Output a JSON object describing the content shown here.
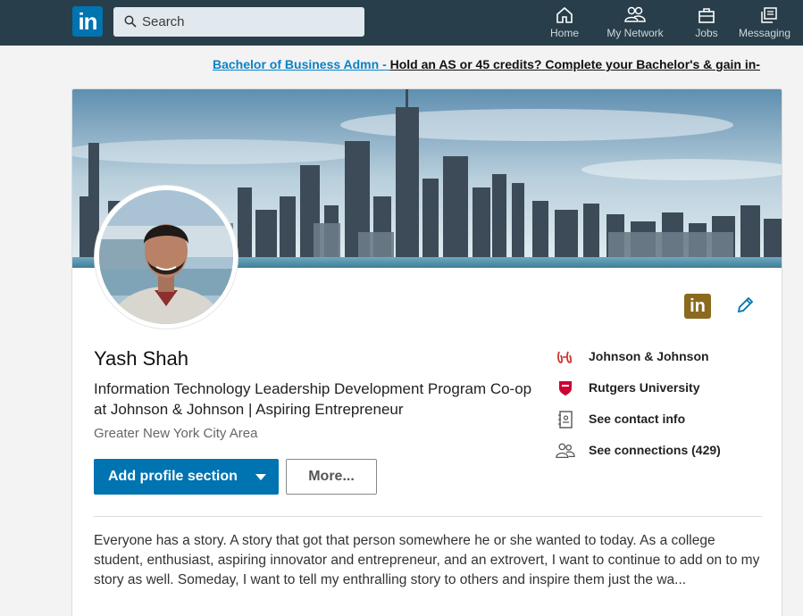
{
  "nav": {
    "logo_text": "in",
    "search_placeholder": "Search",
    "items": [
      {
        "label": "Home",
        "icon": "home-icon"
      },
      {
        "label": "My Network",
        "icon": "network-icon"
      },
      {
        "label": "Jobs",
        "icon": "briefcase-icon"
      },
      {
        "label": "Messaging",
        "icon": "messaging-icon"
      }
    ],
    "colors": {
      "bar": "#283e4a",
      "logo": "#0073b1"
    }
  },
  "promo": {
    "sponsor": "Bachelor of Business Admn - ",
    "text": "Hold an AS or 45 credits? Complete your Bachelor's & gain in-"
  },
  "profile": {
    "name": "Yash Shah",
    "headline": "Information Technology Leadership Development Program Co-op at Johnson & Johnson | Aspiring Entrepreneur",
    "location": "Greater New York City Area",
    "badge_text": "in",
    "add_section_label": "Add profile section",
    "more_label": "More...",
    "side": [
      {
        "label": "Johnson & Johnson",
        "icon": "company-logo-icon"
      },
      {
        "label": "Rutgers University",
        "icon": "school-shield-icon"
      },
      {
        "label": "See contact info",
        "icon": "contact-card-icon"
      },
      {
        "label": "See connections (429)",
        "icon": "connections-icon"
      }
    ],
    "summary": "Everyone has a story. A story that got that person somewhere he or she wanted to today. As a college student, enthusiast, aspiring innovator and entrepreneur, and an extrovert, I want to continue to add on to my story as well. Someday, I want to tell my enthralling story to others and inspire them just the wa..."
  },
  "colors": {
    "primary_button": "#0073b1",
    "premium_badge": "#8a6a1f",
    "link": "#0a82c8"
  }
}
